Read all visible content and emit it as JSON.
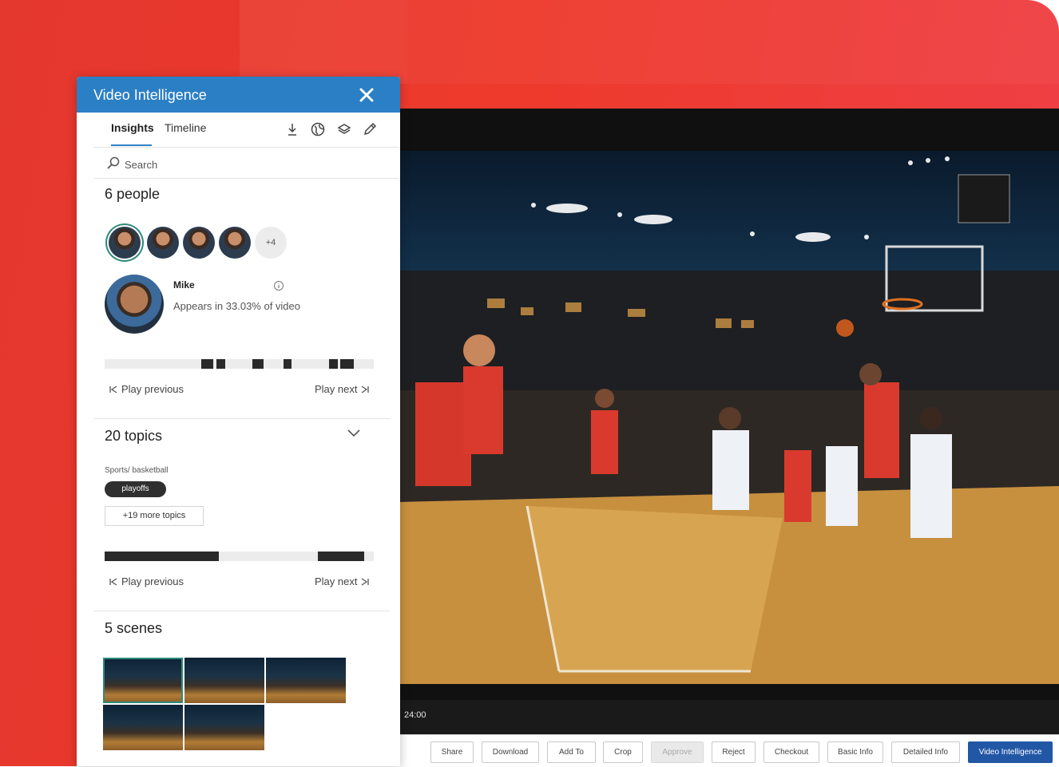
{
  "panel": {
    "title": "Video Intelligence",
    "tabs": [
      {
        "label": "Insights",
        "active": true
      },
      {
        "label": "Timeline",
        "active": false
      }
    ],
    "toolbar_icons": [
      "download-icon",
      "globe-icon",
      "layers-icon",
      "edit-icon"
    ],
    "search": {
      "placeholder": "Search",
      "value": ""
    }
  },
  "people": {
    "title": "6 people",
    "avatars": [
      "person-1",
      "person-2",
      "person-3",
      "person-4"
    ],
    "more_label": "+4",
    "selected": {
      "name": "Mike",
      "stat": "Appears in 33.03% of video"
    },
    "play_previous": "Play previous",
    "play_next": "Play next"
  },
  "topics": {
    "title": "20 topics",
    "category": "Sports/ basketball",
    "chip": "playoffs",
    "more": "+19 more topics",
    "play_previous": "Play previous",
    "play_next": "Play next"
  },
  "scenes": {
    "title": "5 scenes",
    "count": 5
  },
  "player": {
    "time": "24:00"
  },
  "actions": [
    {
      "label": "Share",
      "state": "normal"
    },
    {
      "label": "Download",
      "state": "normal"
    },
    {
      "label": "Add To",
      "state": "normal"
    },
    {
      "label": "Crop",
      "state": "normal"
    },
    {
      "label": "Approve",
      "state": "disabled"
    },
    {
      "label": "Reject",
      "state": "normal"
    },
    {
      "label": "Checkout",
      "state": "normal"
    },
    {
      "label": "Basic Info",
      "state": "normal"
    },
    {
      "label": "Detailed Info",
      "state": "normal"
    },
    {
      "label": "Video Intelligence",
      "state": "primary"
    }
  ],
  "colors": {
    "panel_header": "#2b7fc4",
    "background": "#e4372e",
    "primary_button": "#2257a6",
    "selection_ring": "#2e8a7a"
  }
}
